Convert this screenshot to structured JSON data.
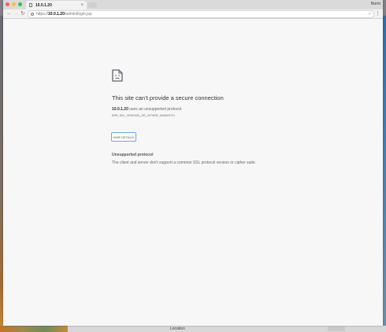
{
  "desktop": {
    "location_label": "Location"
  },
  "browser": {
    "tab": {
      "title": "10.0.1.20",
      "close_glyph": "×"
    },
    "user_name": "Norm",
    "nav": {
      "back": "←",
      "forward": "→",
      "reload": "↻",
      "menu": "⋮",
      "star": "☆"
    },
    "url": {
      "prefix": "https://",
      "host": "10.0.1.20",
      "path": "/admin/login.jsp"
    }
  },
  "error": {
    "icon": "sad-document-icon",
    "heading": "This site can’t provide a secure connection",
    "host": "10.0.1.20",
    "description_suffix": " uses an unsupported protocol.",
    "code": "ERR_SSL_VERSION_OR_CIPHER_MISMATCH",
    "hide_details_label": "HIDE DETAILS",
    "detail_title": "Unsupported protocol",
    "detail_text": "The client and server don't support a common SSL protocol version or cipher suite."
  },
  "colors": {
    "focus_ring": "#6aa5e8",
    "page_bg": "#f7f7f7"
  }
}
